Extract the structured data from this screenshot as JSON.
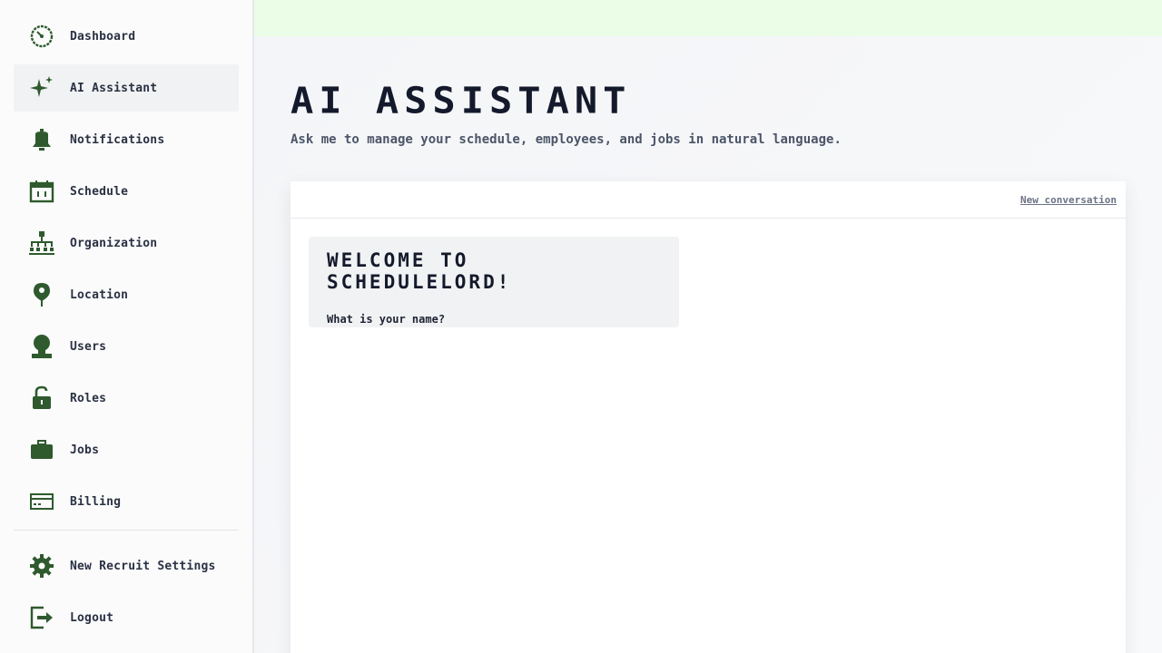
{
  "sidebar": {
    "items": [
      {
        "label": "Dashboard",
        "icon": "dashboard-icon"
      },
      {
        "label": "AI Assistant",
        "icon": "sparkle-icon",
        "active": true
      },
      {
        "label": "Notifications",
        "icon": "bell-icon"
      },
      {
        "label": "Schedule",
        "icon": "calendar-icon"
      },
      {
        "label": "Organization",
        "icon": "org-chart-icon"
      },
      {
        "label": "Location",
        "icon": "map-pin-icon"
      },
      {
        "label": "Users",
        "icon": "user-icon"
      },
      {
        "label": "Roles",
        "icon": "lock-icon"
      },
      {
        "label": "Jobs",
        "icon": "briefcase-icon"
      },
      {
        "label": "Billing",
        "icon": "credit-card-icon"
      }
    ],
    "bottom_items": [
      {
        "label": "New Recruit Settings",
        "icon": "gear-icon"
      },
      {
        "label": "Logout",
        "icon": "logout-icon"
      }
    ]
  },
  "page": {
    "title": "AI Assistant",
    "subtitle": "Ask me to manage your schedule, employees, and jobs in natural language."
  },
  "chat": {
    "new_conversation_label": "New conversation",
    "messages": [
      {
        "heading": "Welcome to Schedulelord!",
        "body": "What is your name?"
      }
    ]
  },
  "colors": {
    "accent": "#2f5a2e",
    "topbar": "#ebfde6",
    "active_item": "#f1f2f4"
  }
}
